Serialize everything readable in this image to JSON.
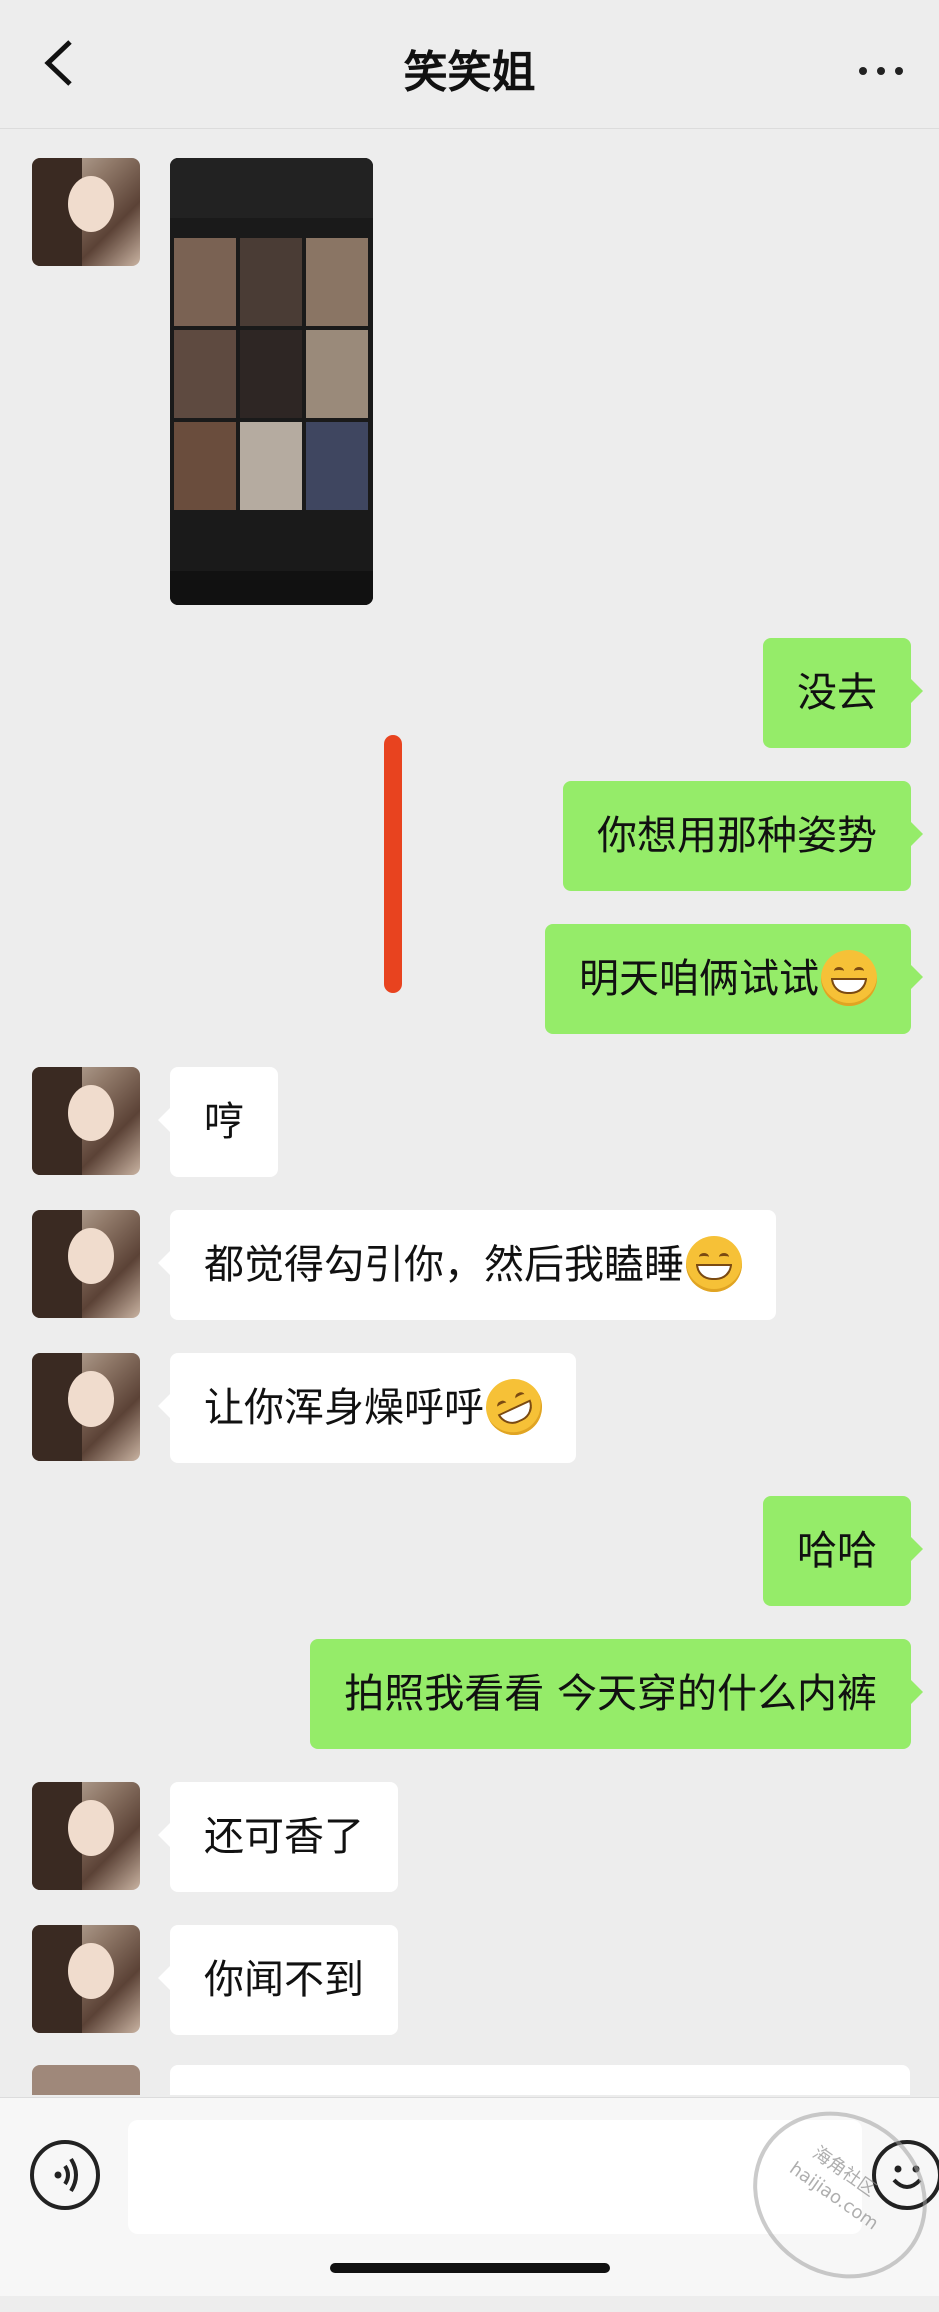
{
  "header": {
    "title": "笑笑姐"
  },
  "messages": [
    {
      "side": "in",
      "type": "image"
    },
    {
      "side": "out",
      "text": "没去"
    },
    {
      "side": "out",
      "text": "你想用那种姿势"
    },
    {
      "side": "out",
      "text": "明天咱俩试试",
      "emoji": "grin-icon"
    },
    {
      "side": "in",
      "text": "哼"
    },
    {
      "side": "in",
      "text": "都觉得勾引你，然后我瞌睡",
      "emoji": "grin-icon"
    },
    {
      "side": "in",
      "text": "让你浑身燥呼呼",
      "emoji": "rofl-icon"
    },
    {
      "side": "out",
      "text": "哈哈"
    },
    {
      "side": "out",
      "text": "拍照我看看 今天穿的什么内裤"
    },
    {
      "side": "in",
      "text": "还可香了"
    },
    {
      "side": "in",
      "text": "你闻不到"
    }
  ],
  "watermark": {
    "cn": "海角社区",
    "en": "haijiao.com"
  },
  "colors": {
    "outgoing": "#95ec69",
    "incoming": "#ffffff",
    "background": "#ededed"
  }
}
